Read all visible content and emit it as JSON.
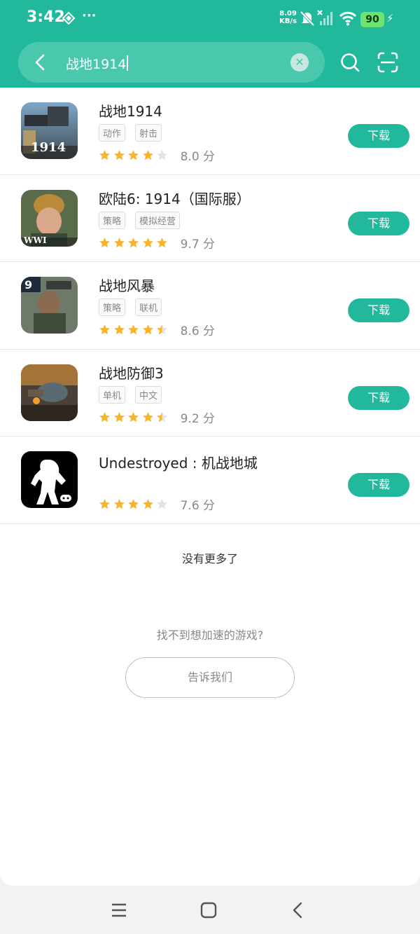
{
  "status": {
    "time": "3:42",
    "dots": "···",
    "net_speed_value": "8.09",
    "net_speed_unit": "KB/s",
    "battery": "90"
  },
  "search": {
    "query": "战地1914"
  },
  "icons": {
    "back": "chevron-left-icon",
    "clear": "clear-icon",
    "search": "search-icon",
    "scan": "scan-icon"
  },
  "colors": {
    "accent": "#21b89c",
    "star_filled": "#f7b42c",
    "star_empty": "#e3e3e3"
  },
  "results": [
    {
      "title": "战地1914",
      "tags": [
        "动作",
        "射击"
      ],
      "rating": 4,
      "score": "8.0 分",
      "button": "下载",
      "icon_text": "1914"
    },
    {
      "title": "欧陆6: 1914（国际服）",
      "tags": [
        "策略",
        "模拟经营"
      ],
      "rating": 5,
      "score": "9.7 分",
      "button": "下载",
      "icon_text": "WWI"
    },
    {
      "title": "战地风暴",
      "tags": [
        "策略",
        "联机"
      ],
      "rating": 4.5,
      "score": "8.6 分",
      "button": "下载",
      "icon_text": "9"
    },
    {
      "title": "战地防御3",
      "tags": [
        "单机",
        "中文"
      ],
      "rating": 4.5,
      "score": "9.2 分",
      "button": "下载",
      "icon_text": ""
    },
    {
      "title": "Undestroyed : 机战地城",
      "tags": [],
      "rating": 4,
      "score": "7.6 分",
      "button": "下载",
      "icon_text": ""
    }
  ],
  "footer": {
    "no_more": "没有更多了",
    "cant_find": "找不到想加速的游戏?",
    "tell_us": "告诉我们"
  },
  "navbar": {
    "menu": "menu-icon",
    "home": "home-icon",
    "back": "back-icon"
  }
}
